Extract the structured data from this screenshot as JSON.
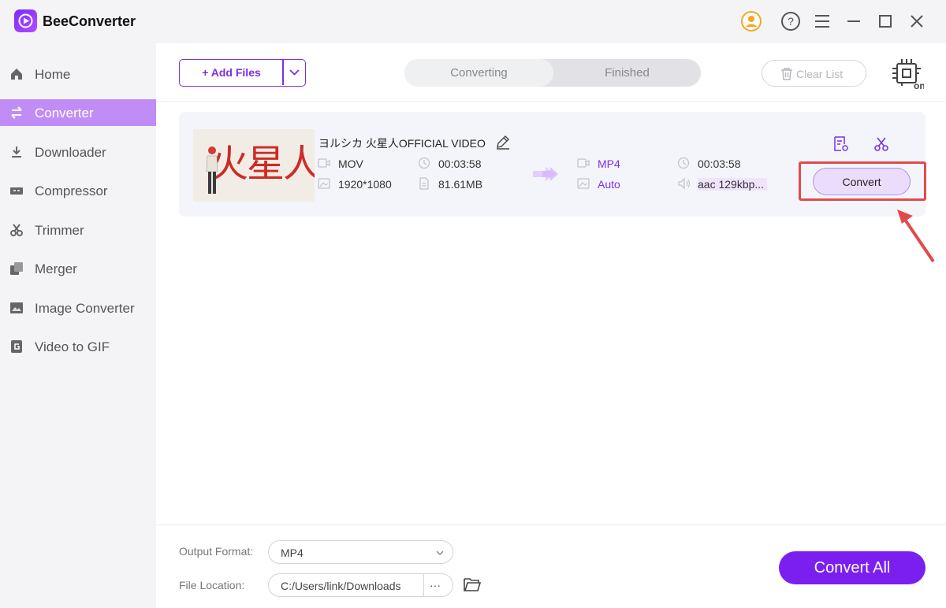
{
  "app": {
    "title": "BeeConverter"
  },
  "sidebar": {
    "items": [
      {
        "label": "Home",
        "icon": "home-icon"
      },
      {
        "label": "Converter",
        "icon": "convert-arrows-icon",
        "active": true
      },
      {
        "label": "Downloader",
        "icon": "download-icon"
      },
      {
        "label": "Compressor",
        "icon": "compress-icon"
      },
      {
        "label": "Trimmer",
        "icon": "scissors-icon"
      },
      {
        "label": "Merger",
        "icon": "merge-icon"
      },
      {
        "label": "Image Converter",
        "icon": "image-icon"
      },
      {
        "label": "Video to GIF",
        "icon": "gif-icon"
      }
    ]
  },
  "toolbar": {
    "add_files": "+ Add Files",
    "tabs": [
      "Converting",
      "Finished"
    ],
    "clear_list": "Clear List"
  },
  "file": {
    "name": "ヨルシカ 火星人OFFICIAL VIDEO",
    "thumbnail_text": "火星人",
    "source": {
      "format": "MOV",
      "duration": "00:03:58",
      "resolution": "1920*1080",
      "size": "81.61MB"
    },
    "target": {
      "format": "MP4",
      "duration": "00:03:58",
      "resolution": "Auto",
      "audio": "aac 129kbp..."
    },
    "convert_label": "Convert"
  },
  "bottom": {
    "output_format_label": "Output Format:",
    "output_format_value": "MP4",
    "file_location_label": "File Location:",
    "file_location_value": "C:/Users/link/Downloads",
    "more_label": "···",
    "convert_all": "Convert All"
  },
  "colors": {
    "accent": "#7b1ff0",
    "sidebar_active": "#c08df6",
    "highlight": "#e24a4a"
  }
}
